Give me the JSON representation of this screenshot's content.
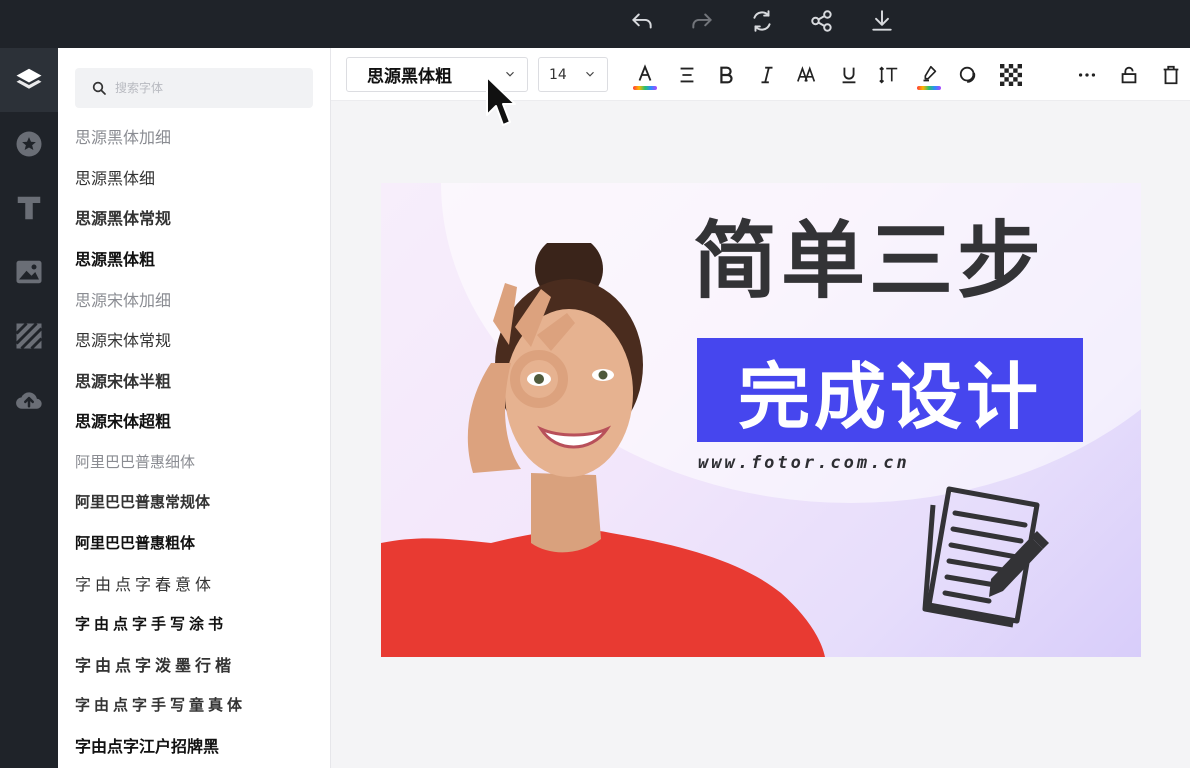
{
  "topbar": {
    "tools": [
      {
        "name": "undo-icon",
        "enabled": true
      },
      {
        "name": "redo-icon",
        "enabled": false
      },
      {
        "name": "refresh-icon",
        "enabled": true
      },
      {
        "name": "share-icon",
        "enabled": true
      },
      {
        "name": "download-icon",
        "enabled": true
      }
    ]
  },
  "rail": {
    "items": [
      {
        "name": "layers-icon",
        "active": true
      },
      {
        "name": "star-icon",
        "active": false
      },
      {
        "name": "text-icon",
        "active": false
      },
      {
        "name": "image-icon",
        "active": false
      },
      {
        "name": "pattern-icon",
        "active": false
      },
      {
        "name": "upload-icon",
        "active": false
      }
    ]
  },
  "font_panel": {
    "search_placeholder": "搜索字体",
    "fonts": [
      {
        "label": "思源黑体加细",
        "style": "light"
      },
      {
        "label": "思源黑体细",
        "style": "regular"
      },
      {
        "label": "思源黑体常规",
        "style": "semi"
      },
      {
        "label": "思源黑体粗",
        "style": "bold"
      },
      {
        "label": "思源宋体加细",
        "style": "light"
      },
      {
        "label": "思源宋体常规",
        "style": "regular"
      },
      {
        "label": "思源宋体半粗",
        "style": "semi"
      },
      {
        "label": "思源宋体超粗",
        "style": "bold"
      },
      {
        "label": "阿里巴巴普惠细体",
        "style": "light small"
      },
      {
        "label": "阿里巴巴普惠常规体",
        "style": "semi small"
      },
      {
        "label": "阿里巴巴普惠粗体",
        "style": "bold small"
      },
      {
        "label": "字由点字春意体",
        "style": "script regular"
      },
      {
        "label": "字由点字手写涂书",
        "style": "script bold small"
      },
      {
        "label": "字由点字泼墨行楷",
        "style": "script semi"
      },
      {
        "label": "字由点字手写童真体",
        "style": "script semi small"
      },
      {
        "label": "字由点字江户招牌黑",
        "style": "bold"
      }
    ]
  },
  "toolbar": {
    "font_family": "思源黑体粗",
    "font_size": "14",
    "buttons": [
      "text-color-icon",
      "align-icon",
      "bold-icon",
      "italic-icon",
      "letter-case-icon",
      "underline-icon",
      "line-spacing-icon",
      "highlight-icon",
      "shadow-icon",
      "transparency-icon",
      "more-icon",
      "lock-icon",
      "delete-icon"
    ]
  },
  "design": {
    "headline": "简单三步",
    "banner_text": "完成设计",
    "url": "www.fotor.com.cn",
    "colors": {
      "banner": "#4646ee",
      "headline": "#333336",
      "shirt": "#e83a32"
    }
  }
}
